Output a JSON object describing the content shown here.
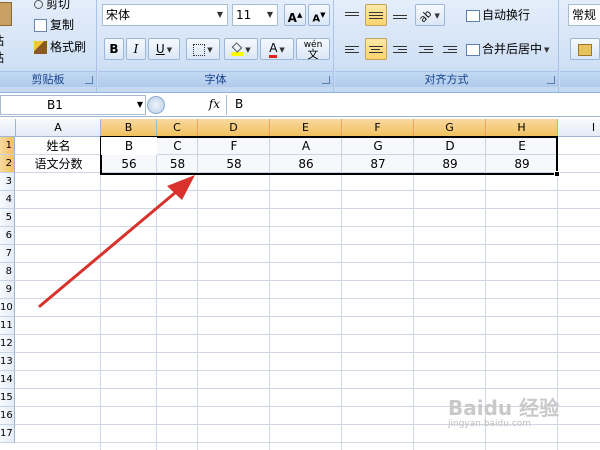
{
  "clipboard": {
    "cut": "剪切",
    "copy": "复制",
    "format_painter": "格式刷",
    "paste": "粘贴",
    "group_label": "剪贴板"
  },
  "font": {
    "name": "宋体",
    "size": "11",
    "bold": "B",
    "italic": "I",
    "underline": "U",
    "font_color_letter": "A",
    "phonetic": "wén",
    "phonetic_char": "文",
    "group_label": "字体"
  },
  "alignment": {
    "wrap_text": "自动换行",
    "merge_center": "合并后居中",
    "group_label": "对齐方式"
  },
  "number": {
    "format": "常规"
  },
  "formula_bar": {
    "name_box": "B1",
    "fx": "fx",
    "content": "B"
  },
  "grid": {
    "columns": [
      "A",
      "B",
      "C",
      "D",
      "E",
      "F",
      "G",
      "H",
      "I"
    ],
    "rows": [
      "1",
      "2",
      "3",
      "4",
      "5",
      "6",
      "7",
      "8",
      "9",
      "10",
      "11",
      "12",
      "13",
      "14",
      "15",
      "16",
      "17"
    ],
    "row1": [
      "姓名",
      "B",
      "C",
      "F",
      "A",
      "G",
      "D",
      "E"
    ],
    "row2": [
      "语文分数",
      "56",
      "58",
      "58",
      "86",
      "87",
      "89",
      "89"
    ]
  },
  "colors": {
    "arrow": "#d9312b",
    "selection_header": "#f1c15f",
    "ribbon": "#d3e2f6"
  }
}
